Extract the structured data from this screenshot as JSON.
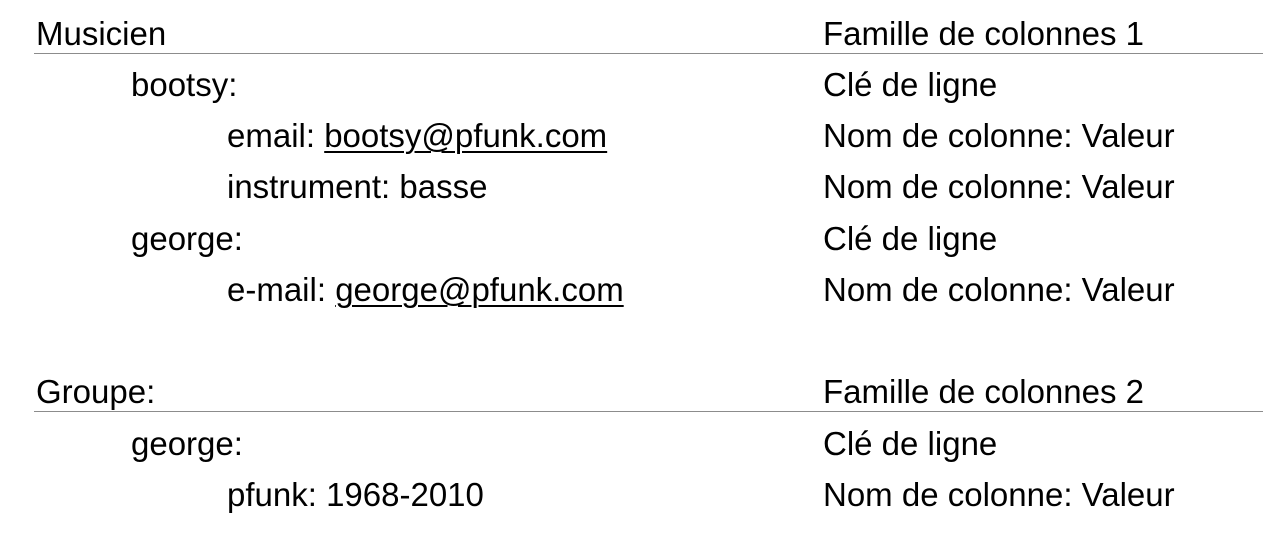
{
  "families": [
    {
      "name": "Musicien",
      "label": "Famille de colonnes 1",
      "rows": [
        {
          "key": "bootsy:",
          "key_label": "Clé de ligne",
          "columns": [
            {
              "name": "email:",
              "value": "bootsy@pfunk.com",
              "link": true,
              "label": "Nom de colonne: Valeur"
            },
            {
              "name": "instrument:",
              "value": "basse",
              "link": false,
              "label": "Nom de colonne: Valeur"
            }
          ]
        },
        {
          "key": "george:",
          "key_label": "Clé de ligne",
          "columns": [
            {
              "name": "e-mail:",
              "value": "george@pfunk.com",
              "link": true,
              "label": "Nom de colonne: Valeur"
            }
          ]
        }
      ]
    },
    {
      "name": "Groupe:",
      "label": "Famille de colonnes 2",
      "rows": [
        {
          "key": "george:",
          "key_label": "Clé de ligne",
          "columns": [
            {
              "name": "pfunk:",
              "value": "1968-2010",
              "link": false,
              "label": "Nom de colonne: Valeur"
            }
          ]
        }
      ]
    }
  ],
  "colors": {
    "text": "#000000",
    "rule": "#8c8c8c",
    "background": "#ffffff"
  }
}
